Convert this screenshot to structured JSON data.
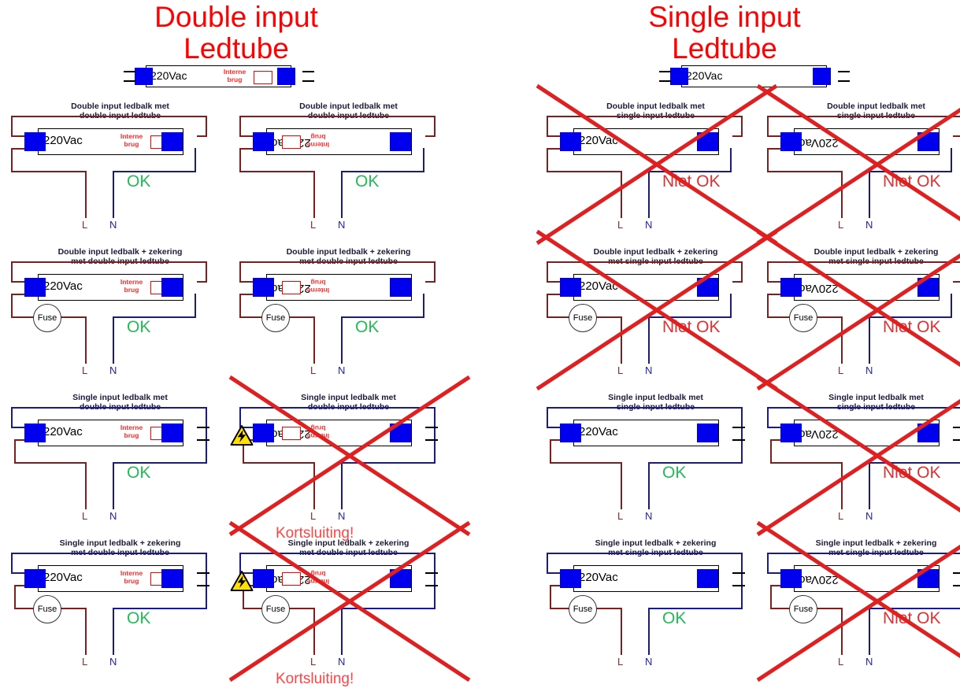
{
  "columns": [
    {
      "title": "Double input\nLedtube",
      "color": "#ff0000"
    },
    {
      "title": "Single input\nLedtube",
      "color": "#ff0000"
    }
  ],
  "labels": {
    "vac": "220Vac",
    "interne_brug": "Interne\nbrug",
    "fuse": "Fuse",
    "line": "L",
    "neutral": "N",
    "ok": "OK",
    "niet_ok": "Niet OK",
    "kortsluiting": "Kortsluiting!"
  },
  "colors": {
    "title_red": "#ff0000",
    "pin_blue": "#0000ee",
    "live_wire": "#7a2020",
    "neutral_wire": "#1a1a8a",
    "ok_green": "#22bb55",
    "niet_ok_red": "#e03030",
    "short_red": "#ff4444",
    "cross_red": "#e02020",
    "brug_red": "#ff0000",
    "warn_yellow": "#ffe000"
  },
  "cells": [
    {
      "id": "c1",
      "caption": "Double input ledbalk met\ndouble input ledtube",
      "ledbalk": "double",
      "tube": "double",
      "tube_flipped": false,
      "fuse": false,
      "verdict": "OK",
      "verdict_kind": "ok",
      "crossed": false,
      "warning": false
    },
    {
      "id": "c2",
      "caption": "Double input ledbalk met\ndouble input ledtube",
      "ledbalk": "double",
      "tube": "double",
      "tube_flipped": true,
      "fuse": false,
      "verdict": "OK",
      "verdict_kind": "ok",
      "crossed": false,
      "warning": false
    },
    {
      "id": "c3",
      "caption": "Double input ledbalk met\nsingle input ledtube",
      "ledbalk": "double",
      "tube": "single",
      "tube_flipped": false,
      "fuse": false,
      "verdict": "Niet OK",
      "verdict_kind": "no",
      "crossed": true,
      "warning": false
    },
    {
      "id": "c4",
      "caption": "Double input ledbalk met\nsingle input ledtube",
      "ledbalk": "double",
      "tube": "single",
      "tube_flipped": true,
      "fuse": false,
      "verdict": "Niet OK",
      "verdict_kind": "no",
      "crossed": true,
      "warning": false
    },
    {
      "id": "c5",
      "caption": "Double input ledbalk + zekering\nmet double input ledtube",
      "ledbalk": "double",
      "tube": "double",
      "tube_flipped": false,
      "fuse": true,
      "verdict": "OK",
      "verdict_kind": "ok",
      "crossed": false,
      "warning": false
    },
    {
      "id": "c6",
      "caption": "Double input ledbalk + zekering\nmet double input ledtube",
      "ledbalk": "double",
      "tube": "double",
      "tube_flipped": true,
      "fuse": true,
      "verdict": "OK",
      "verdict_kind": "ok",
      "crossed": false,
      "warning": false
    },
    {
      "id": "c7",
      "caption": "Double input ledbalk + zekering\nmet single input ledtube",
      "ledbalk": "double",
      "tube": "single",
      "tube_flipped": false,
      "fuse": true,
      "verdict": "Niet OK",
      "verdict_kind": "no",
      "crossed": true,
      "warning": false
    },
    {
      "id": "c8",
      "caption": "Double input ledbalk + zekering\nmet single input ledtube",
      "ledbalk": "double",
      "tube": "single",
      "tube_flipped": true,
      "fuse": true,
      "verdict": "Niet OK",
      "verdict_kind": "no",
      "crossed": true,
      "warning": false
    },
    {
      "id": "c9",
      "caption": "Single input ledbalk met\ndouble input ledtube",
      "ledbalk": "single",
      "tube": "double",
      "tube_flipped": false,
      "fuse": false,
      "verdict": "OK",
      "verdict_kind": "ok",
      "crossed": false,
      "warning": false
    },
    {
      "id": "c10",
      "caption": "Single input ledbalk met\ndouble input ledtube",
      "ledbalk": "single",
      "tube": "double",
      "tube_flipped": true,
      "fuse": false,
      "verdict": "Kortsluiting!",
      "verdict_kind": "short",
      "crossed": true,
      "warning": true
    },
    {
      "id": "c11",
      "caption": "Single input ledbalk met\nsingle input ledtube",
      "ledbalk": "single",
      "tube": "single",
      "tube_flipped": false,
      "fuse": false,
      "verdict": "OK",
      "verdict_kind": "ok",
      "crossed": false,
      "warning": false
    },
    {
      "id": "c12",
      "caption": "Single input ledbalk met\nsingle input ledtube",
      "ledbalk": "single",
      "tube": "single",
      "tube_flipped": true,
      "fuse": false,
      "verdict": "Niet OK",
      "verdict_kind": "no",
      "crossed": true,
      "warning": false
    },
    {
      "id": "c13",
      "caption": "Single input ledbalk + zekering\nmet double input ledtube",
      "ledbalk": "single",
      "tube": "double",
      "tube_flipped": false,
      "fuse": true,
      "verdict": "OK",
      "verdict_kind": "ok",
      "crossed": false,
      "warning": false
    },
    {
      "id": "c14",
      "caption": "Single input ledbalk + zekering\nmet double input ledtube",
      "ledbalk": "single",
      "tube": "double",
      "tube_flipped": true,
      "fuse": true,
      "verdict": "Kortsluiting!",
      "verdict_kind": "short",
      "crossed": true,
      "warning": true
    },
    {
      "id": "c15",
      "caption": "Single input ledbalk + zekering\nmet single input ledtube",
      "ledbalk": "single",
      "tube": "single",
      "tube_flipped": false,
      "fuse": true,
      "verdict": "OK",
      "verdict_kind": "ok",
      "crossed": false,
      "warning": false
    },
    {
      "id": "c16",
      "caption": "Single input ledbalk + zekering\nmet single input ledtube",
      "ledbalk": "single",
      "tube": "single",
      "tube_flipped": true,
      "fuse": true,
      "verdict": "Niet OK",
      "verdict_kind": "no",
      "crossed": true,
      "warning": false
    }
  ],
  "header_tubes": [
    {
      "id": "h1",
      "tube": "double",
      "vac": "220Vac"
    },
    {
      "id": "h2",
      "tube": "single",
      "vac": "220Vac"
    }
  ]
}
